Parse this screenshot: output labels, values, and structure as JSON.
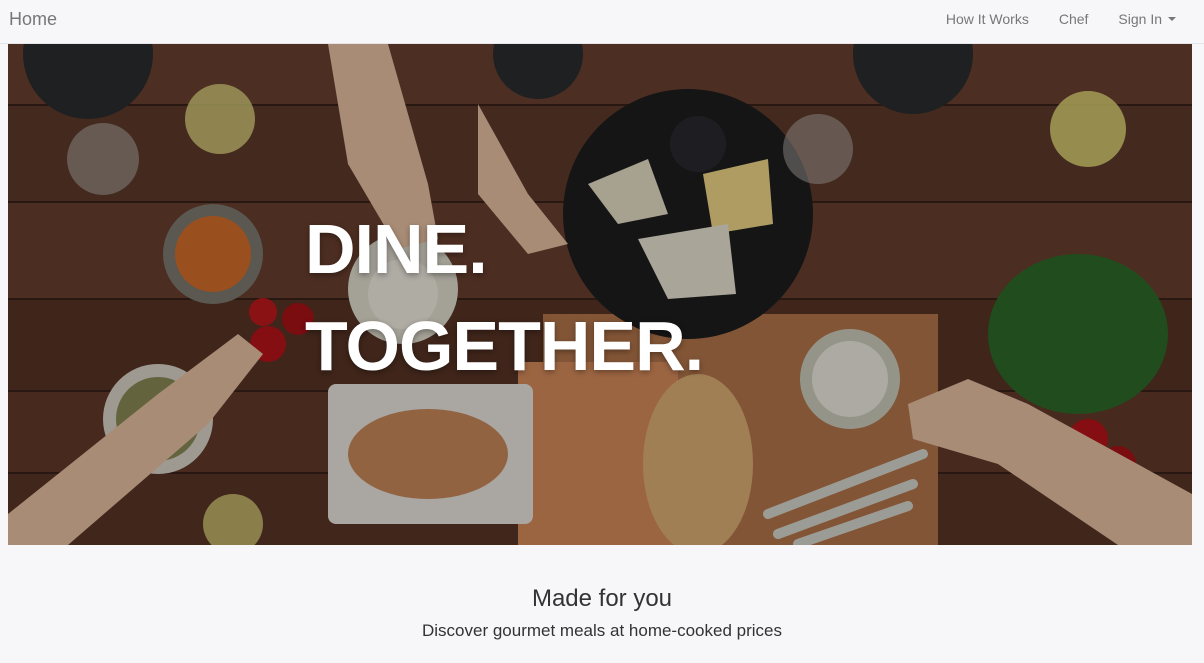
{
  "navbar": {
    "brand": "Home",
    "links": [
      {
        "label": "How It Works"
      },
      {
        "label": "Chef"
      },
      {
        "label": "Sign In",
        "dropdown": true
      }
    ]
  },
  "hero": {
    "line1": "DINE.",
    "line2": "TOGETHER."
  },
  "section": {
    "title": "Made for you",
    "subtitle": "Discover gourmet meals at home-cooked prices"
  }
}
